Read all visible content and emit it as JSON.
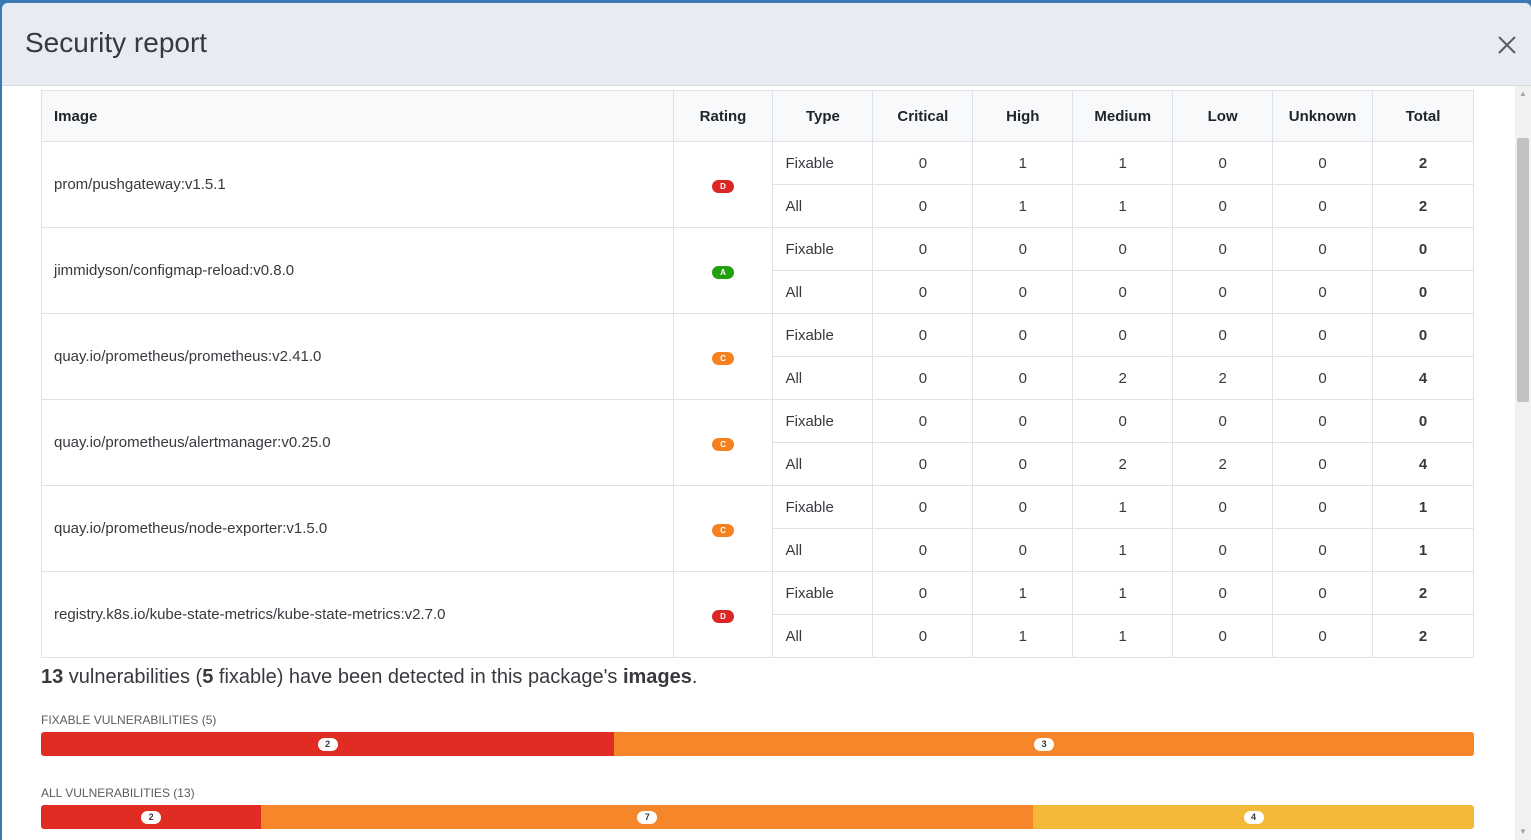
{
  "modal": {
    "title": "Security report"
  },
  "table": {
    "headers": [
      "Image",
      "Rating",
      "Type",
      "Critical",
      "High",
      "Medium",
      "Low",
      "Unknown",
      "Total"
    ],
    "rows": [
      {
        "image": "prom/pushgateway:v1.5.1",
        "rating": "D",
        "rating_color": "#dc2626",
        "fixable": [
          "Fixable",
          "0",
          "1",
          "1",
          "0",
          "0",
          "2"
        ],
        "all": [
          "All",
          "0",
          "1",
          "1",
          "0",
          "0",
          "2"
        ]
      },
      {
        "image": "jimmidyson/configmap-reload:v0.8.0",
        "rating": "A",
        "rating_color": "#22a00f",
        "fixable": [
          "Fixable",
          "0",
          "0",
          "0",
          "0",
          "0",
          "0"
        ],
        "all": [
          "All",
          "0",
          "0",
          "0",
          "0",
          "0",
          "0"
        ]
      },
      {
        "image": "quay.io/prometheus/prometheus:v2.41.0",
        "rating": "C",
        "rating_color": "#f5821f",
        "fixable": [
          "Fixable",
          "0",
          "0",
          "0",
          "0",
          "0",
          "0"
        ],
        "all": [
          "All",
          "0",
          "0",
          "2",
          "2",
          "0",
          "4"
        ]
      },
      {
        "image": "quay.io/prometheus/alertmanager:v0.25.0",
        "rating": "C",
        "rating_color": "#f5821f",
        "fixable": [
          "Fixable",
          "0",
          "0",
          "0",
          "0",
          "0",
          "0"
        ],
        "all": [
          "All",
          "0",
          "0",
          "2",
          "2",
          "0",
          "4"
        ]
      },
      {
        "image": "quay.io/prometheus/node-exporter:v1.5.0",
        "rating": "C",
        "rating_color": "#f5821f",
        "fixable": [
          "Fixable",
          "0",
          "0",
          "1",
          "0",
          "0",
          "1"
        ],
        "all": [
          "All",
          "0",
          "0",
          "1",
          "0",
          "0",
          "1"
        ]
      },
      {
        "image": "registry.k8s.io/kube-state-metrics/kube-state-metrics:v2.7.0",
        "rating": "D",
        "rating_color": "#dc2626",
        "fixable": [
          "Fixable",
          "0",
          "1",
          "1",
          "0",
          "0",
          "2"
        ],
        "all": [
          "All",
          "0",
          "1",
          "1",
          "0",
          "0",
          "2"
        ]
      }
    ]
  },
  "summary": {
    "total": "13",
    "text1": " vulnerabilities (",
    "fixable": "5",
    "text2": " fixable) have been detected in this package's ",
    "images": "images",
    "text3": "."
  },
  "fixable_bar": {
    "label": "Fixable vulnerabilities (5)",
    "segments": [
      {
        "count": "2",
        "share": 0.4,
        "color": "#e02c22"
      },
      {
        "count": "3",
        "share": 0.6,
        "color": "#f5862a"
      }
    ]
  },
  "all_bar": {
    "label": "All vulnerabilities (13)",
    "segments": [
      {
        "count": "2",
        "share": 0.1538,
        "color": "#e02c22"
      },
      {
        "count": "7",
        "share": 0.5385,
        "color": "#f5862a"
      },
      {
        "count": "4",
        "share": 0.3077,
        "color": "#f5b93a"
      }
    ]
  },
  "colors": {
    "header_bg": "#e6ecf2",
    "backdrop": "#3a7ab3"
  }
}
